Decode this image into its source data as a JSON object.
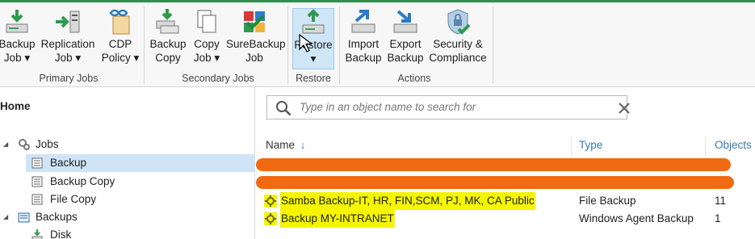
{
  "ribbon": {
    "buttons": [
      {
        "label": "Backup\nJob ▾",
        "icon": "backup-job-icon"
      },
      {
        "label": "Replication\nJob ▾",
        "icon": "replication-job-icon"
      },
      {
        "label": "CDP\nPolicy ▾",
        "icon": "cdp-policy-icon"
      },
      {
        "label": "Backup\nCopy",
        "icon": "backup-copy-icon"
      },
      {
        "label": "Copy\nJob ▾",
        "icon": "copy-job-icon"
      },
      {
        "label": "SureBackup\nJob",
        "icon": "surebackup-job-icon"
      },
      {
        "label": "Restore\n▾",
        "icon": "restore-icon"
      },
      {
        "label": "Import\nBackup",
        "icon": "import-backup-icon"
      },
      {
        "label": "Export\nBackup",
        "icon": "export-backup-icon"
      },
      {
        "label": "Security &\nCompliance",
        "icon": "security-compliance-icon"
      }
    ],
    "groups": [
      "Primary Jobs",
      "Secondary Jobs",
      "Restore",
      "Actions"
    ]
  },
  "nav": {
    "home": "Home",
    "items": [
      {
        "label": "Jobs",
        "icon": "gears-icon"
      },
      {
        "label": "Backup",
        "icon": "backup-node-icon"
      },
      {
        "label": "Backup Copy",
        "icon": "backup-copy-node-icon"
      },
      {
        "label": "File Copy",
        "icon": "file-copy-node-icon"
      },
      {
        "label": "Backups",
        "icon": "backups-icon"
      },
      {
        "label": "Disk",
        "icon": "disk-icon"
      }
    ]
  },
  "search": {
    "placeholder": "Type in an object name to search for"
  },
  "table": {
    "columns": [
      "Name",
      "Type",
      "Objects"
    ],
    "sort_indicator": "↓",
    "rows": [
      {
        "name": "Samba Backup-IT, HR, FIN,SCM, PJ, MK, CA Public",
        "type": "File Backup",
        "objects": "11"
      },
      {
        "name": "Backup MY-INTRANET",
        "type": "Windows Agent Backup",
        "objects": "1"
      }
    ]
  },
  "colors": {
    "accent": "#2f8f4e",
    "selection": "#cfe4f6",
    "header_link": "#3a78b7",
    "highlight": "#f5f500",
    "redaction": "#f06a12"
  }
}
